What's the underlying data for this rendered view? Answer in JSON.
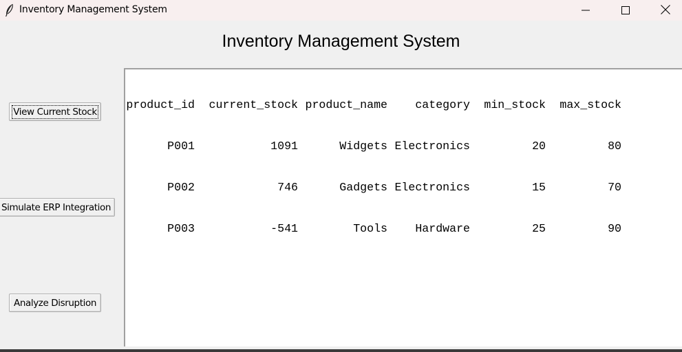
{
  "window": {
    "title": "Inventory Management System",
    "icon": "feather-icon",
    "controls": {
      "minimize": "minimize-icon",
      "maximize": "maximize-icon",
      "close": "close-icon"
    }
  },
  "heading": "Inventory Management System",
  "buttons": {
    "view_stock": "View Current Stock",
    "simulate_erp": "Simulate ERP Integration",
    "analyze": "Analyze Disruption"
  },
  "table": {
    "columns": [
      "product_id",
      "current_stock",
      "product_name",
      "category",
      "min_stock",
      "max_stock"
    ],
    "rows": [
      [
        "P001",
        "1091",
        "Widgets",
        "Electronics",
        "20",
        "80"
      ],
      [
        "P002",
        "746",
        "Gadgets",
        "Electronics",
        "15",
        "70"
      ],
      [
        "P003",
        "-541",
        "Tools",
        "Hardware",
        "25",
        "90"
      ]
    ]
  }
}
